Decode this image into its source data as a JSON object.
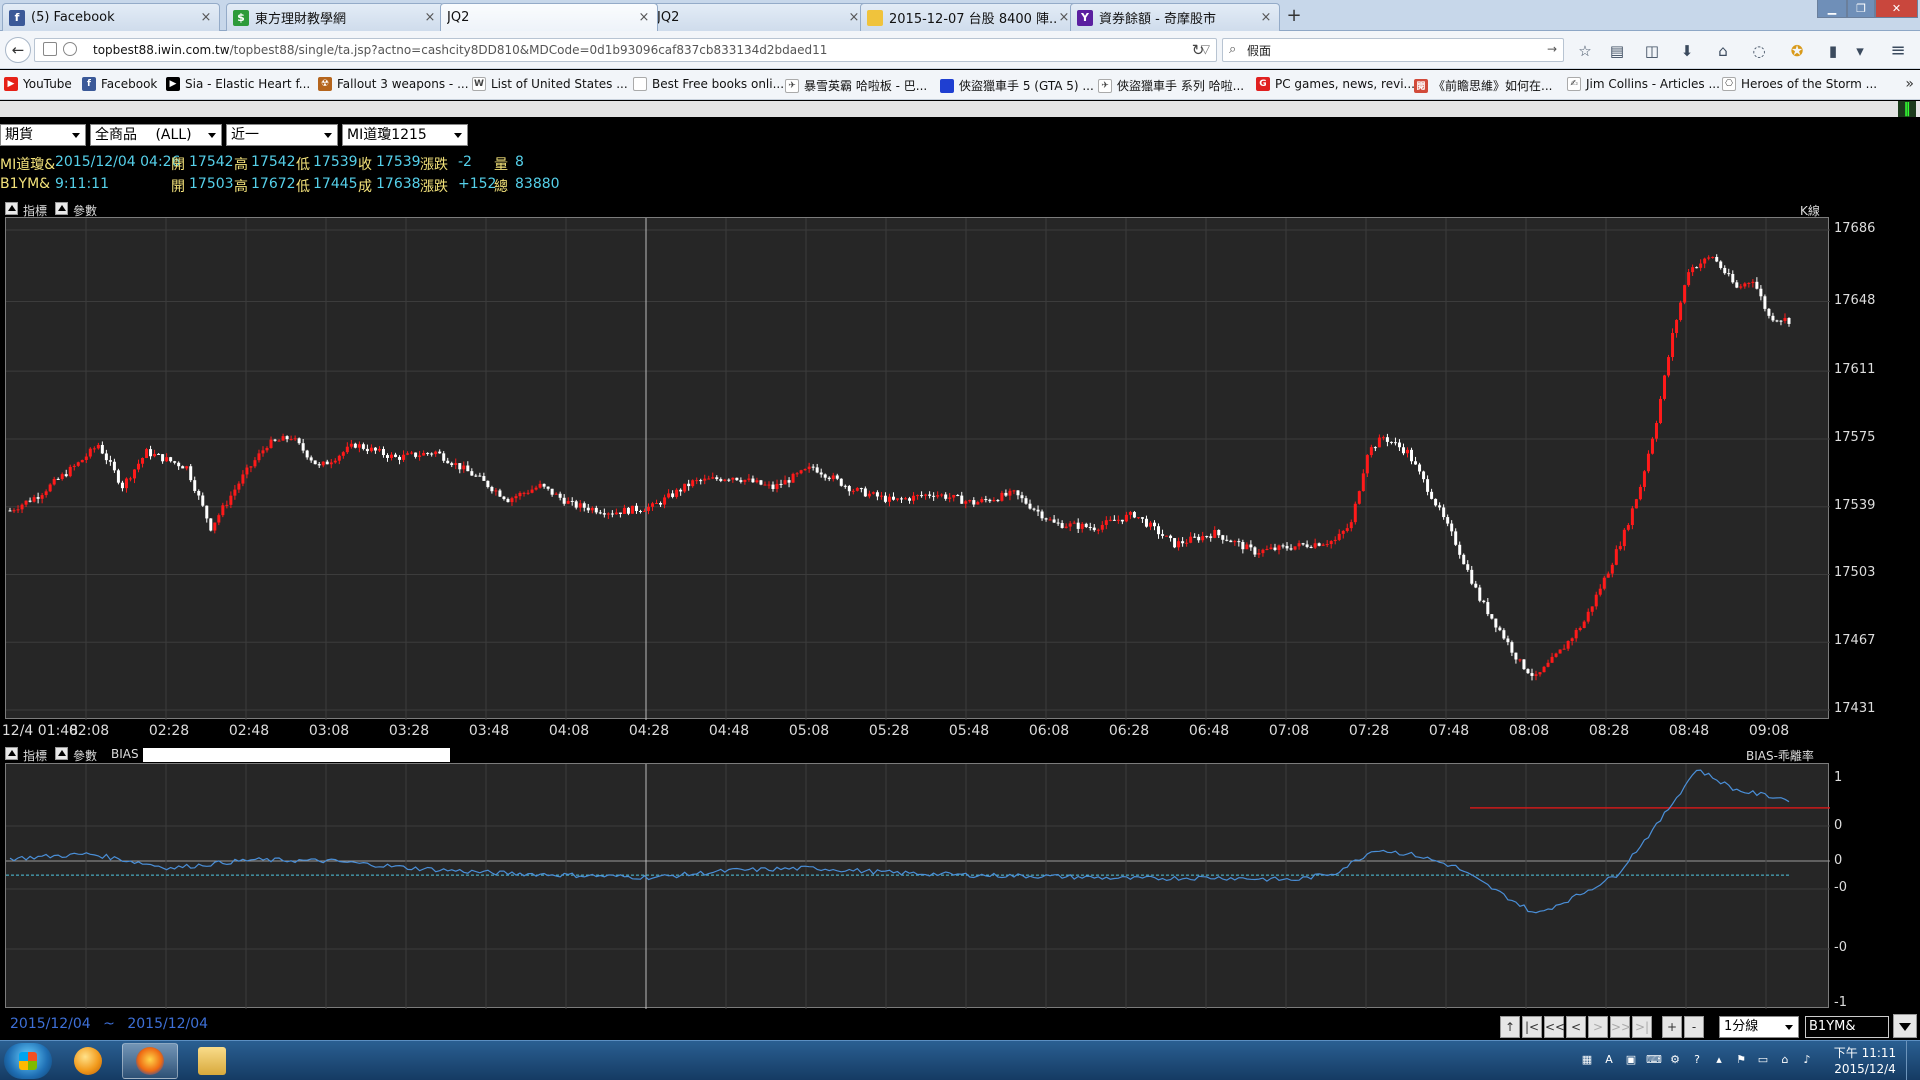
{
  "browser": {
    "tabs": [
      {
        "title": "(5) Facebook",
        "icon": "facebook-icon",
        "color": "#3b5998",
        "glyph": "f"
      },
      {
        "title": "東方理財教學網",
        "icon": "dollar-icon",
        "color": "#2e9b3a",
        "glyph": "$"
      },
      {
        "title": "JQ2",
        "icon": "",
        "color": "",
        "glyph": ""
      },
      {
        "title": "JQ2",
        "icon": "",
        "color": "",
        "glyph": ""
      },
      {
        "title": "2015-12-07 台股 8400 陣...",
        "icon": "note-icon",
        "color": "#f0c33c",
        "glyph": ""
      },
      {
        "title": "資券餘額 - 奇摩股市",
        "icon": "yahoo-icon",
        "color": "#5b1fa0",
        "glyph": "Y"
      }
    ],
    "close_glyph": "×",
    "new_tab_glyph": "+",
    "url_host": "topbest88.iwin.com.tw",
    "url_path": "/topbest88/single/ta.jsp?actno=cashcity8DD810&MDCode=0d1b93096caf837cb833134d2bdaed11",
    "search_value": "假面",
    "bookmarks": [
      {
        "label": "YouTube",
        "color": "#e62117",
        "glyph": "▶"
      },
      {
        "label": "Facebook",
        "color": "#3b5998",
        "glyph": "f"
      },
      {
        "label": "Sia - Elastic Heart f...",
        "color": "#000000",
        "glyph": "▶"
      },
      {
        "label": "Fallout 3 weapons - ...",
        "color": "#b5651d",
        "glyph": "☢"
      },
      {
        "label": "List of United States ...",
        "color": "#ffffff",
        "glyph": "W"
      },
      {
        "label": "Best Free books onli...",
        "color": "#ffffff",
        "glyph": ""
      },
      {
        "label": "暴雪英霸 哈啦板 - 巴...",
        "color": "#ffffff",
        "glyph": "✈"
      },
      {
        "label": "俠盜獵車手 5 (GTA 5) ...",
        "color": "#1f3fd1",
        "glyph": ""
      },
      {
        "label": "俠盜獵車手 系列 哈啦...",
        "color": "#ffffff",
        "glyph": "✈"
      },
      {
        "label": "PC games, news, revi...",
        "color": "#e02020",
        "glyph": "G"
      },
      {
        "label": "《前瞻思維》如何在...",
        "color": "#d24a3a",
        "glyph": "閱"
      },
      {
        "label": "Jim Collins - Articles ...",
        "color": "#ffffff",
        "glyph": "✍"
      },
      {
        "label": "Heroes of the Storm ...",
        "color": "#ffffff",
        "glyph": "⎔"
      }
    ],
    "more_glyph": "»"
  },
  "app": {
    "selectors": {
      "market": "期貨",
      "products": "全商品　 (ALL)",
      "range": "近一",
      "symbol": "MI道瓊1215"
    },
    "quote1": {
      "name": "MI道瓊&",
      "time": "2015/12/04 04:26",
      "open_label": "開",
      "open": "17542",
      "high_label": "高",
      "high": "17542",
      "low_label": "低",
      "low": "17539",
      "close_label": "收",
      "close": "17539",
      "chg_label": "漲跌",
      "chg": "-2",
      "vol_label": "量",
      "vol": "8"
    },
    "quote2": {
      "name": "B1YM&",
      "time": "9:11:11",
      "open_label": "開",
      "open": "17503",
      "high_label": "高",
      "high": "17672",
      "low_label": "低",
      "low": "17445",
      "close_label": "成",
      "close": "17638",
      "chg_label": "漲跌",
      "chg": "+152",
      "vol_label": "總",
      "vol": "83880"
    },
    "panel1": {
      "indicator_label": "指標",
      "param_label": "參數",
      "title": "K線"
    },
    "panel2": {
      "indicator_label": "指標",
      "param_label": "參數",
      "name": "BIAS",
      "title": "BIAS-乖離率"
    },
    "price_ticks": [
      "17686",
      "17648",
      "17611",
      "17575",
      "17539",
      "17503",
      "17467",
      "17431"
    ],
    "bias_ticks": [
      "1",
      "0",
      "0",
      "-0",
      "-0",
      "-1"
    ],
    "time_ticks": [
      "12/4 01:48",
      "02:08",
      "02:28",
      "02:48",
      "03:08",
      "03:28",
      "03:48",
      "04:08",
      "04:28",
      "04:48",
      "05:08",
      "05:28",
      "05:48",
      "06:08",
      "06:28",
      "06:48",
      "07:08",
      "07:28",
      "07:48",
      "08:08",
      "08:28",
      "08:48",
      "09:08"
    ],
    "date_from": "2015/12/04",
    "date_sep": "~",
    "date_to": "2015/12/04",
    "nav_buttons": [
      "↑",
      "|<",
      "<<",
      "<",
      ">",
      ">>",
      ">|",
      "+",
      "-"
    ],
    "period": "1分線",
    "symbol_box": "B1YM&"
  },
  "chart_data": {
    "type": "candlestick",
    "title": "K線",
    "interval": "1 minute",
    "x_range": [
      "12/4 01:48",
      "09:11"
    ],
    "ylim": [
      17431,
      17686
    ],
    "grid": true,
    "close_path": [
      [
        "01:48",
        17537
      ],
      [
        "01:55",
        17545
      ],
      [
        "02:05",
        17562
      ],
      [
        "02:10",
        17572
      ],
      [
        "02:16",
        17550
      ],
      [
        "02:22",
        17568
      ],
      [
        "02:32",
        17560
      ],
      [
        "02:38",
        17528
      ],
      [
        "02:46",
        17555
      ],
      [
        "02:52",
        17572
      ],
      [
        "02:58",
        17576
      ],
      [
        "03:05",
        17560
      ],
      [
        "03:14",
        17572
      ],
      [
        "03:24",
        17565
      ],
      [
        "03:34",
        17568
      ],
      [
        "03:44",
        17555
      ],
      [
        "03:52",
        17543
      ],
      [
        "04:00",
        17550
      ],
      [
        "04:08",
        17540
      ],
      [
        "04:18",
        17536
      ],
      [
        "04:28",
        17539
      ],
      [
        "04:38",
        17552
      ],
      [
        "04:48",
        17555
      ],
      [
        "04:58",
        17549
      ],
      [
        "05:08",
        17560
      ],
      [
        "05:18",
        17548
      ],
      [
        "05:28",
        17542
      ],
      [
        "05:38",
        17546
      ],
      [
        "05:48",
        17541
      ],
      [
        "05:58",
        17546
      ],
      [
        "06:08",
        17530
      ],
      [
        "06:18",
        17528
      ],
      [
        "06:28",
        17535
      ],
      [
        "06:38",
        17519
      ],
      [
        "06:48",
        17525
      ],
      [
        "06:58",
        17515
      ],
      [
        "07:08",
        17518
      ],
      [
        "07:18",
        17521
      ],
      [
        "07:22",
        17530
      ],
      [
        "07:26",
        17568
      ],
      [
        "07:30",
        17576
      ],
      [
        "07:36",
        17568
      ],
      [
        "07:42",
        17545
      ],
      [
        "07:48",
        17520
      ],
      [
        "07:54",
        17490
      ],
      [
        "08:00",
        17470
      ],
      [
        "08:04",
        17456
      ],
      [
        "08:08",
        17448
      ],
      [
        "08:14",
        17462
      ],
      [
        "08:20",
        17478
      ],
      [
        "08:26",
        17505
      ],
      [
        "08:30",
        17525
      ],
      [
        "08:34",
        17550
      ],
      [
        "08:38",
        17585
      ],
      [
        "08:42",
        17630
      ],
      [
        "08:46",
        17665
      ],
      [
        "08:52",
        17672
      ],
      [
        "08:58",
        17655
      ],
      [
        "09:02",
        17660
      ],
      [
        "09:06",
        17640
      ],
      [
        "09:11",
        17638
      ]
    ],
    "bias_series": {
      "name": "BIAS",
      "ylim": [
        -1,
        1
      ],
      "points": [
        [
          "01:48",
          0.02
        ],
        [
          "02:08",
          0.06
        ],
        [
          "02:28",
          -0.06
        ],
        [
          "02:48",
          0.01
        ],
        [
          "03:08",
          0.0
        ],
        [
          "03:28",
          -0.06
        ],
        [
          "03:48",
          -0.1
        ],
        [
          "04:08",
          -0.12
        ],
        [
          "04:28",
          -0.14
        ],
        [
          "04:48",
          -0.08
        ],
        [
          "05:08",
          -0.06
        ],
        [
          "05:28",
          -0.1
        ],
        [
          "05:48",
          -0.12
        ],
        [
          "06:08",
          -0.13
        ],
        [
          "06:28",
          -0.15
        ],
        [
          "06:48",
          -0.14
        ],
        [
          "07:08",
          -0.16
        ],
        [
          "07:18",
          -0.1
        ],
        [
          "07:28",
          0.1
        ],
        [
          "07:38",
          0.05
        ],
        [
          "07:48",
          -0.05
        ],
        [
          "07:58",
          -0.25
        ],
        [
          "08:08",
          -0.45
        ],
        [
          "08:18",
          -0.3
        ],
        [
          "08:28",
          -0.12
        ],
        [
          "08:38",
          0.3
        ],
        [
          "08:48",
          0.78
        ],
        [
          "08:58",
          0.6
        ],
        [
          "09:11",
          0.52
        ]
      ],
      "baseline": -0.12,
      "reference_line": 0.45
    },
    "colors": {
      "up": "#ff1a1a",
      "down": "#ffffff",
      "bias": "#4a8fd8",
      "baseline": "#4fc7e0",
      "reference": "#cc1a1a"
    }
  }
}
